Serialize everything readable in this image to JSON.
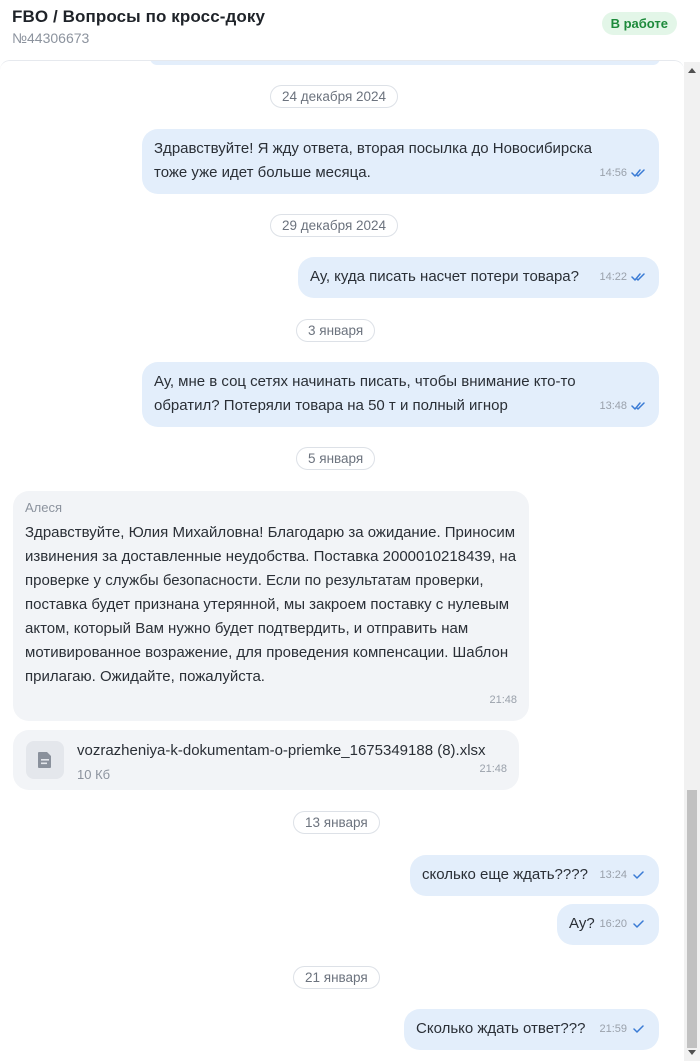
{
  "header": {
    "title": "FBO / Вопросы по кросс-доку",
    "ticket_id": "№44306673",
    "status": "В работе"
  },
  "colors": {
    "outgoing_bubble": "#e3eefb",
    "incoming_bubble": "#f2f4f7",
    "status_bg": "#e3f6e8",
    "status_text": "#1d8a3b",
    "read_check": "#3a7bd5"
  },
  "dates": [
    "24 декабря 2024",
    "29 декабря 2024",
    "3 января",
    "5 января",
    "13 января",
    "21 января"
  ],
  "messages": [
    {
      "text": "Здравствуйте! Я жду ответа, вторая посылка до Новосибирска тоже уже идет больше месяца.",
      "time": "14:56",
      "status_icon": "double-check-icon"
    },
    {
      "text": "Ау, куда писать насчет потери товара?",
      "time": "14:22",
      "status_icon": "double-check-icon"
    },
    {
      "text": "Ау, мне в соц сетях начинать писать, чтобы внимание кто-то обратил? Потеряли товара на 50 т и полный игнор",
      "time": "13:48",
      "status_icon": "double-check-icon"
    },
    {
      "author": "Алеся",
      "text": "Здравствуйте, Юлия Михайловна! Благодарю за ожидание. Приносим извинения за доставленные неудобства. Поставка 2000010218439, на проверке у службы безопасности. Если по результатам проверки, поставка будет признана утерянной, мы закроем поставку с нулевым актом, который Вам нужно будет подтвердить, и отправить нам мотивированное возражение, для проведения компенсации. Шаблон прилагаю. Ожидайте, пожалуйста.",
      "time": "21:48"
    },
    {
      "file_name": "vozrazheniya-k-dokumentam-o-priemke_1675349188 (8).xlsx",
      "file_size": "10 Кб",
      "time": "21:48",
      "icon": "document-icon"
    },
    {
      "text": "сколько еще ждать????",
      "time": "13:24",
      "status_icon": "check-icon"
    },
    {
      "text": "Ау?",
      "time": "16:20",
      "status_icon": "check-icon"
    },
    {
      "text": "Сколько ждать ответ???",
      "time": "21:59",
      "status_icon": "check-icon"
    }
  ]
}
